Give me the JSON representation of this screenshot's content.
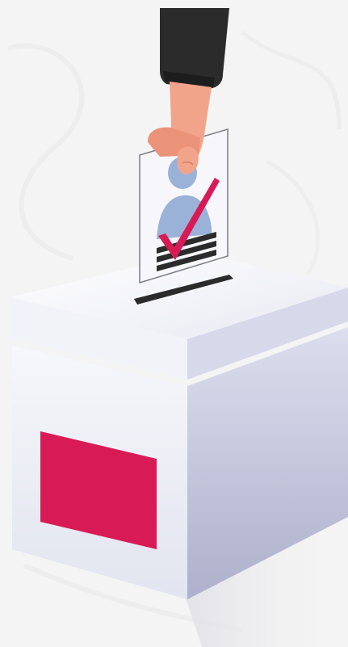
{
  "scene": {
    "description_label": "",
    "colors": {
      "background": "#f4f4f4",
      "sleeve": "#2b2b2b",
      "skin": "#f2a48a",
      "paper": "#f7f7fb",
      "silhouette": "#9bb2d8",
      "check": "#d81b57",
      "label_panel": "#d81b57",
      "box_front": "#eef0f6",
      "box_side": "#c9cbe0",
      "box_top": "#f6f7fb",
      "slot": "#2b2b2b"
    },
    "icons": [
      "ballot-box-icon",
      "ballot-paper-icon",
      "checkmark-icon",
      "hand-icon"
    ]
  }
}
